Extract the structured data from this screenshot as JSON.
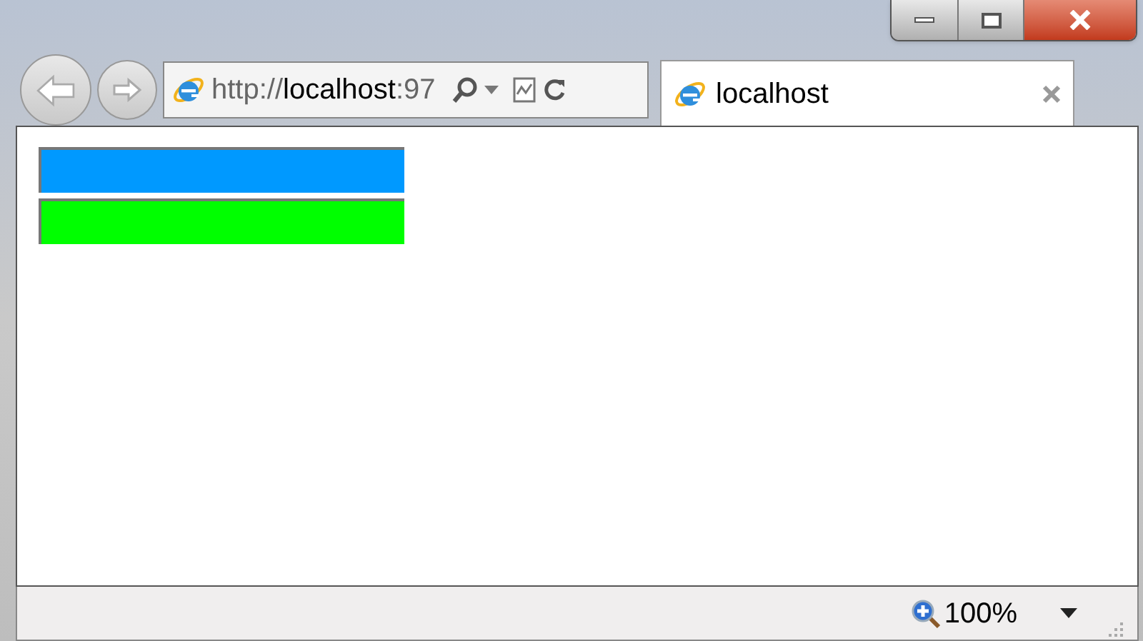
{
  "address": {
    "scheme": "http://",
    "host": "localhost",
    "port": ":97"
  },
  "tab": {
    "title": "localhost",
    "selected": true
  },
  "blocks": [
    {
      "color": "#0099ff"
    },
    {
      "color": "#00ff00"
    }
  ],
  "status_bar": {
    "zoom": "100%"
  }
}
